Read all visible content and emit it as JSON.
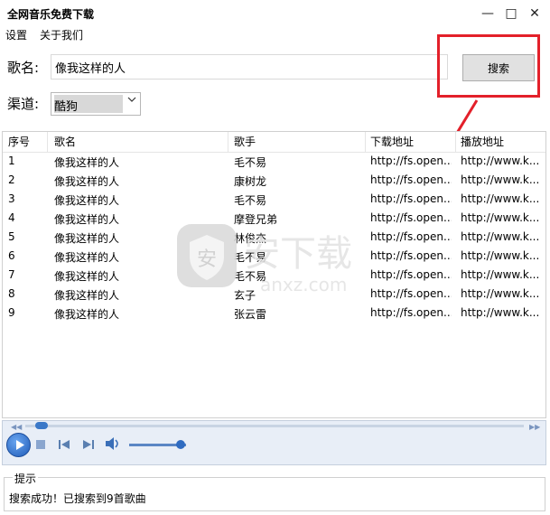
{
  "window": {
    "title": "全网音乐免费下载",
    "min_glyph": "—",
    "max_glyph": "□",
    "close_glyph": "✕"
  },
  "menu": {
    "settings": "设置",
    "about": "关于我们"
  },
  "form": {
    "song_label": "歌名:",
    "song_value": "像我这样的人",
    "search_label": "搜索",
    "channel_label": "渠道:",
    "channel_value": "酷狗"
  },
  "table": {
    "columns": [
      "序号",
      "歌名",
      "歌手",
      "下载地址",
      "播放地址"
    ],
    "rows": [
      [
        "1",
        "像我这样的人",
        "毛不易",
        "http://fs.open...",
        "http://www.k..."
      ],
      [
        "2",
        "像我这样的人",
        "康树龙",
        "http://fs.open...",
        "http://www.k..."
      ],
      [
        "3",
        "像我这样的人",
        "毛不易",
        "http://fs.open...",
        "http://www.k..."
      ],
      [
        "4",
        "像我这样的人",
        "摩登兄弟",
        "http://fs.open...",
        "http://www.k..."
      ],
      [
        "5",
        "像我这样的人",
        "林俊杰",
        "http://fs.open...",
        "http://www.k..."
      ],
      [
        "6",
        "像我这样的人",
        "毛不易",
        "http://fs.open...",
        "http://www.k..."
      ],
      [
        "7",
        "像我这样的人",
        "毛不易",
        "http://fs.open...",
        "http://www.k..."
      ],
      [
        "8",
        "像我这样的人",
        "玄子",
        "http://fs.open...",
        "http://www.k..."
      ],
      [
        "9",
        "像我这样的人",
        "张云雷",
        "http://fs.open...",
        "http://www.k..."
      ]
    ]
  },
  "watermark": {
    "text": "安下载",
    "url": "anxz.com"
  },
  "player": {
    "seek_fraction": 0.02,
    "volume_fraction": 0.9
  },
  "status": {
    "title": "提示",
    "message": "搜索成功！已搜索到9首歌曲"
  },
  "colors": {
    "highlight": "#e3202a",
    "accent": "#2f6bc1"
  }
}
